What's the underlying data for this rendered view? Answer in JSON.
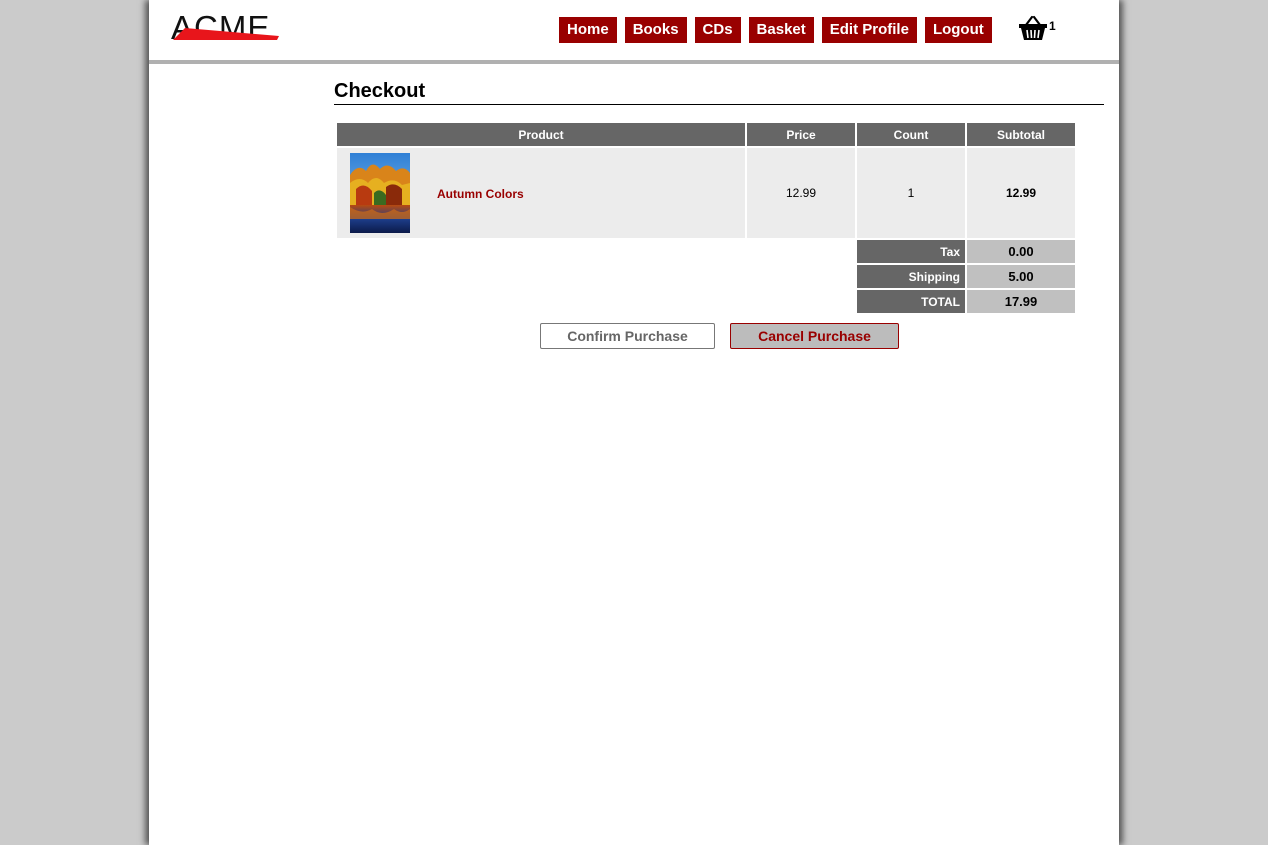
{
  "brand": {
    "logo_text": "ACME",
    "accent_color": "#990000"
  },
  "nav": {
    "items": [
      {
        "label": "Home"
      },
      {
        "label": "Books"
      },
      {
        "label": "CDs"
      },
      {
        "label": "Basket"
      },
      {
        "label": "Edit Profile"
      },
      {
        "label": "Logout"
      }
    ]
  },
  "basket": {
    "icon": "basket-icon",
    "count": "1"
  },
  "page": {
    "title": "Checkout"
  },
  "cart": {
    "columns": [
      "Product",
      "Price",
      "Count",
      "Subtotal"
    ],
    "items": [
      {
        "image": "autumn-landscape-thumbnail",
        "name": "Autumn Colors",
        "price": "12.99",
        "count": "1",
        "subtotal": "12.99"
      }
    ],
    "summary": {
      "tax_label": "Tax",
      "tax_value": "0.00",
      "shipping_label": "Shipping",
      "shipping_value": "5.00",
      "total_label": "TOTAL",
      "total_value": "17.99"
    }
  },
  "actions": {
    "confirm_label": "Confirm Purchase",
    "cancel_label": "Cancel Purchase"
  }
}
